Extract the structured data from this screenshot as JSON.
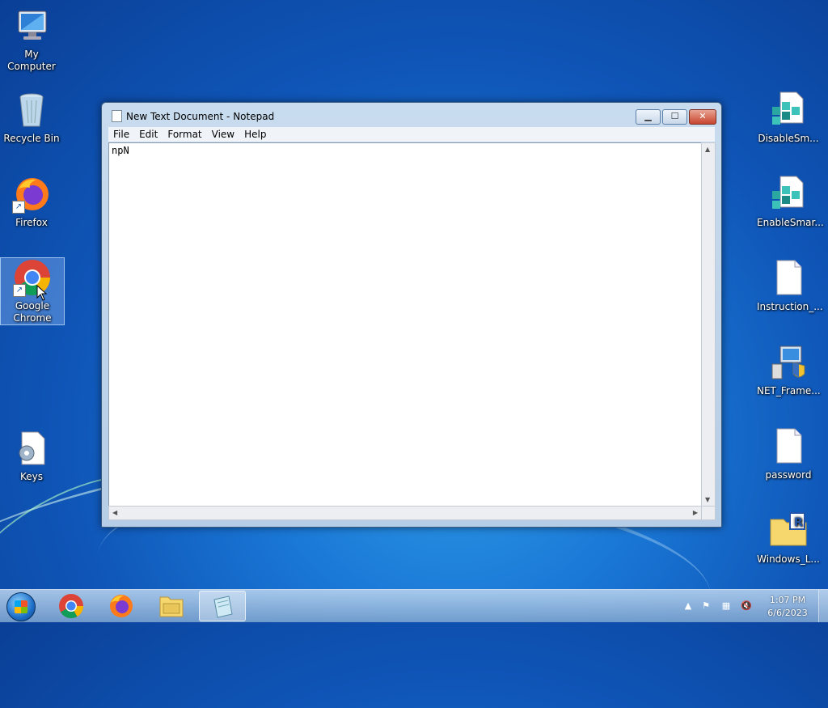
{
  "desktop": {
    "left_icons": [
      {
        "label": "My Computer",
        "icon": "computer-icon"
      },
      {
        "label": "Recycle Bin",
        "icon": "recycle-bin-icon"
      },
      {
        "label": "Firefox",
        "icon": "firefox-icon"
      },
      {
        "label": "Google Chrome",
        "icon": "chrome-icon"
      },
      {
        "label": "Keys",
        "icon": "settings-file-icon"
      }
    ],
    "right_icons": [
      {
        "label": "DisableSm...",
        "icon": "registry-file-icon"
      },
      {
        "label": "EnableSmar...",
        "icon": "registry-file-icon"
      },
      {
        "label": "Instruction_...",
        "icon": "text-file-icon"
      },
      {
        "label": "NET_Frame...",
        "icon": "installer-icon"
      },
      {
        "label": "password",
        "icon": "text-file-icon"
      },
      {
        "label": "Windows_L...",
        "icon": "folder-icon"
      }
    ]
  },
  "notepad": {
    "title": "New Text Document - Notepad",
    "menu": [
      "File",
      "Edit",
      "Format",
      "View",
      "Help"
    ],
    "content": "npN",
    "buttons": {
      "minimize": "▁",
      "maximize": "☐",
      "close": "✕"
    }
  },
  "taskbar": {
    "apps": [
      "chrome-icon",
      "firefox-icon",
      "file-explorer-icon",
      "notepad-icon"
    ],
    "time": "1:07 PM",
    "date": "6/6/2023",
    "tray_icons": [
      "show-hidden-icons-icon",
      "action-center-icon",
      "network-icon",
      "volume-muted-icon"
    ]
  },
  "colors": {
    "accent": "#1a78d6",
    "close_button": "#c7452e"
  }
}
